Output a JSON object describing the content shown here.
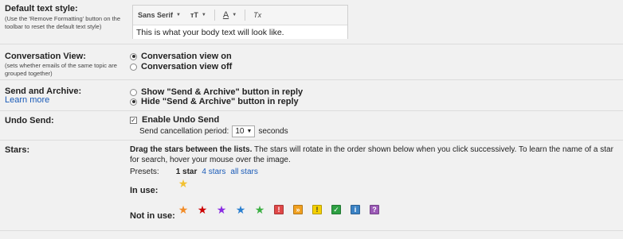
{
  "default_text_style": {
    "label": "Default text style:",
    "description": "(Use the 'Remove Formatting' button on the toolbar to reset the default text style)",
    "font_label": "Sans Serif",
    "size_glyph": "тT",
    "color_glyph": "A",
    "remove_glyph": "Tx",
    "preview": "This is what your body text will look like."
  },
  "conversation_view": {
    "label": "Conversation View:",
    "description": "(sets whether emails of the same topic are grouped together)",
    "options": [
      {
        "label": "Conversation view on",
        "selected": true
      },
      {
        "label": "Conversation view off",
        "selected": false
      }
    ]
  },
  "send_archive": {
    "label": "Send and Archive:",
    "learn_more": "Learn more",
    "options": [
      {
        "label": "Show \"Send & Archive\" button in reply",
        "selected": false
      },
      {
        "label": "Hide \"Send & Archive\" button in reply",
        "selected": true
      }
    ]
  },
  "undo_send": {
    "label": "Undo Send:",
    "checkbox_label": "Enable Undo Send",
    "checked": true,
    "period_label": "Send cancellation period:",
    "period_value": "10",
    "period_unit": "seconds"
  },
  "stars": {
    "label": "Stars:",
    "intro_bold": "Drag the stars between the lists.",
    "intro_rest": "  The stars will rotate in the order shown below when you click successively. To learn the name of a star for search, hover your mouse over the image.",
    "presets_label": "Presets:",
    "presets": [
      "1 star",
      "4 stars",
      "all stars"
    ],
    "in_use_label": "In use:",
    "not_in_use_label": "Not in use:",
    "in_use": [
      {
        "kind": "star",
        "color": "#f2c132"
      }
    ],
    "not_in_use": [
      {
        "kind": "star",
        "color": "#f28c28"
      },
      {
        "kind": "star",
        "color": "#cc0000"
      },
      {
        "kind": "star",
        "color": "#8a2be2"
      },
      {
        "kind": "star",
        "color": "#2a7fd0"
      },
      {
        "kind": "star",
        "color": "#3cb043"
      },
      {
        "kind": "bang",
        "glyph": "!",
        "color": "#e04848"
      },
      {
        "kind": "guillemet",
        "glyph": "»",
        "color": "#f0a020"
      },
      {
        "kind": "bang",
        "glyph": "!",
        "color": "#f5d000"
      },
      {
        "kind": "check",
        "glyph": "✓",
        "color": "#2ea043"
      },
      {
        "kind": "info",
        "glyph": "i",
        "color": "#3b82c4"
      },
      {
        "kind": "question",
        "glyph": "?",
        "color": "#9b59b6"
      }
    ]
  }
}
